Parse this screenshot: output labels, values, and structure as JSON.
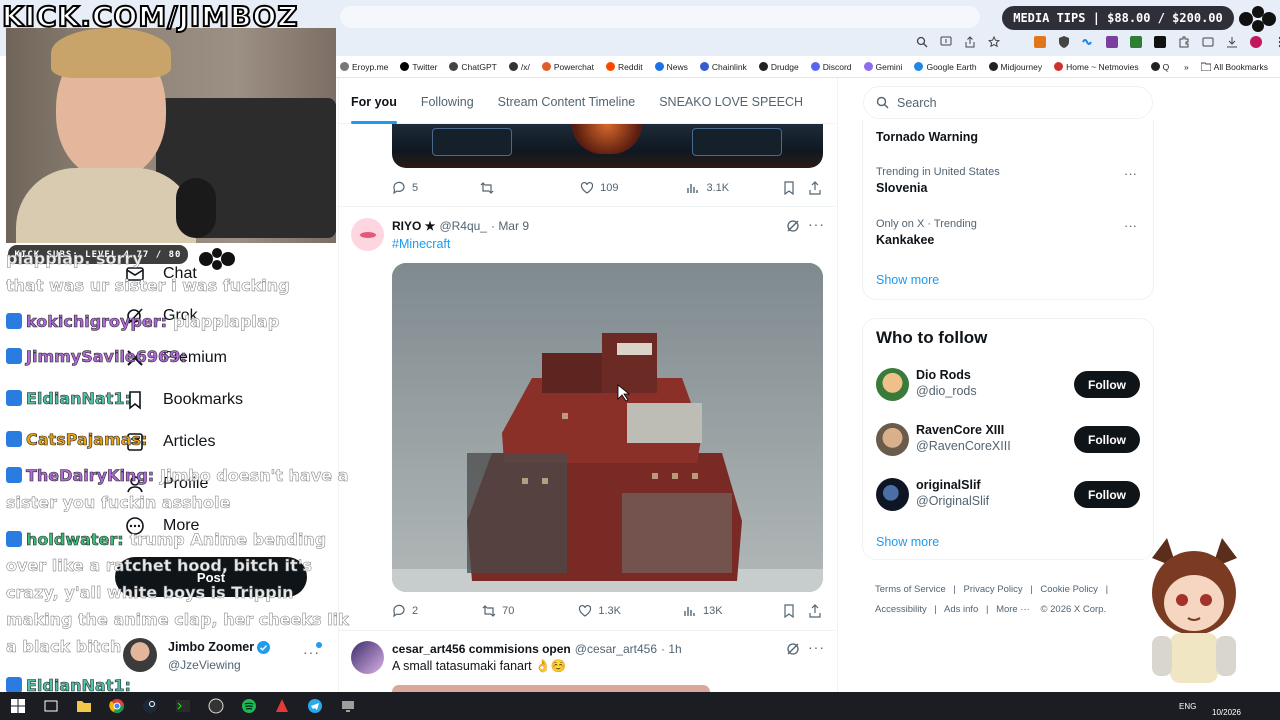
{
  "overlay": {
    "kick_url": "KICK.COM/JIMBOZ",
    "subs_bar": "KICK SUBS: LEVEL 4 77 / 80",
    "media_tips": "MEDIA TIPS | $88.00 / $200.00"
  },
  "browser": {
    "bookmarks": [
      {
        "label": "Eroyp.me",
        "icon": "bookmark-generic-icon",
        "color": "#777777"
      },
      {
        "label": "Twitter",
        "icon": "x-logo-icon",
        "color": "#000000"
      },
      {
        "label": "ChatGPT",
        "icon": "chatgpt-icon",
        "color": "#444444"
      },
      {
        "label": "/x/",
        "icon": "grid-icon",
        "color": "#333333"
      },
      {
        "label": "Powerchat",
        "icon": "powerchat-icon",
        "color": "#e05c2b"
      },
      {
        "label": "Reddit",
        "icon": "reddit-icon",
        "color": "#ff4500"
      },
      {
        "label": "News",
        "icon": "news-icon",
        "color": "#1a73e8"
      },
      {
        "label": "Chainlink",
        "icon": "chainlink-icon",
        "color": "#375bd2"
      },
      {
        "label": "Drudge",
        "icon": "drudge-icon",
        "color": "#222222"
      },
      {
        "label": "Discord",
        "icon": "discord-icon",
        "color": "#5865f2"
      },
      {
        "label": "Gemini",
        "icon": "gemini-icon",
        "color": "#8e6cf0"
      },
      {
        "label": "Google Earth",
        "icon": "google-earth-icon",
        "color": "#1e88e5"
      },
      {
        "label": "Midjourney",
        "icon": "midjourney-icon",
        "color": "#222222"
      },
      {
        "label": "Home ~ Netmovies",
        "icon": "netmovies-icon",
        "color": "#d32f2f"
      },
      {
        "label": "Q",
        "icon": "q-icon",
        "color": "#222222"
      }
    ],
    "all_bookmarks": "All Bookmarks",
    "overflow": "»"
  },
  "feed": {
    "tabs": [
      "For you",
      "Following",
      "Stream Content Timeline",
      "SNEAKO LOVE SPEECH"
    ],
    "active_tab": 0,
    "post1": {
      "replies": "5",
      "reposts": "",
      "likes": "109",
      "views": "3.1K"
    },
    "post2": {
      "name": "RIYO ★",
      "handle": "@R4qu_",
      "date": "· Mar 9",
      "text": "#Minecraft",
      "replies": "2",
      "reposts": "70",
      "likes": "1.3K",
      "views": "13K"
    },
    "post3": {
      "name": "cesar_art456 commisions open",
      "handle": "@cesar_art456",
      "date": "· 1h",
      "text": "A small tatasumaki fanart 👌☺️"
    }
  },
  "sidebar_nav": {
    "items": [
      "Chat",
      "Grok",
      "Premium",
      "Bookmarks",
      "Articles",
      "Profile",
      "More"
    ],
    "post_button": "Post",
    "account": {
      "name": "Jimbo Zoomer",
      "handle": "@JzeViewing"
    }
  },
  "search": {
    "placeholder": "Search"
  },
  "trends": [
    {
      "context": "",
      "name": "Tornado Warning"
    },
    {
      "context": "Trending in United States",
      "name": "Slovenia"
    },
    {
      "context": "Only on X · Trending",
      "name": "Kankakee"
    }
  ],
  "trends_show_more": "Show more",
  "who_to_follow": {
    "title": "Who to follow",
    "button": "Follow",
    "show_more": "Show more",
    "accounts": [
      {
        "name": "Dio Rods",
        "handle": "@dio_rods"
      },
      {
        "name": "RavenCore XIII",
        "handle": "@RavenCoreXIII"
      },
      {
        "name": "originalSlif",
        "handle": "@OriginalSlif"
      }
    ]
  },
  "footer": {
    "links": [
      "Terms of Service",
      "Privacy Policy",
      "Cookie Policy",
      "Accessibility",
      "Ads info",
      "More ···"
    ],
    "copyright": "© 2026 X Corp."
  },
  "chat": {
    "messages": [
      {
        "user": "",
        "text": "plapplap. sorry",
        "color": "#ffffff"
      },
      {
        "user": "",
        "text": "that was ur sister i was fucking",
        "color": "#ffffff"
      },
      {
        "user": "kokichigroyper:",
        "text": "plapplaplap",
        "color": "#b06ad9"
      },
      {
        "user": "JimmySavile6969:",
        "text": "",
        "color": "#b06ad9"
      },
      {
        "user": "EldianNat1:",
        "text": "",
        "color": "#4fc3a8"
      },
      {
        "user": "CatsPajamas:",
        "text": "",
        "color": "#e8a317"
      },
      {
        "user": "TheDairyKing:",
        "text": "Jimbo doesn't have a",
        "color": "#b06ad9"
      },
      {
        "user": "",
        "text": "sister you fuckin asshole",
        "color": "#ffffff"
      },
      {
        "user": "holdwater:",
        "text": "trump Anime bending",
        "color": "#3dbf7a"
      },
      {
        "user": "",
        "text": "over like a ratchet hood, bitch it's",
        "color": "#ffffff"
      },
      {
        "user": "",
        "text": "crazy, y'all white boys is Trippin",
        "color": "#ffffff"
      },
      {
        "user": "",
        "text": "making the anime clap, her cheeks lik",
        "color": "#ffffff"
      },
      {
        "user": "",
        "text": "a black bitch",
        "color": "#ffffff"
      },
      {
        "user": "EldianNat1:",
        "text": "",
        "color": "#4fc3a8"
      }
    ]
  },
  "taskbar": {
    "lang": "ENG",
    "date": "10/2026"
  },
  "colors": {
    "x_blue": "#1d9bf0",
    "text_primary": "#0f1419",
    "text_secondary": "#536471",
    "taskbar": "#1b1d23"
  }
}
